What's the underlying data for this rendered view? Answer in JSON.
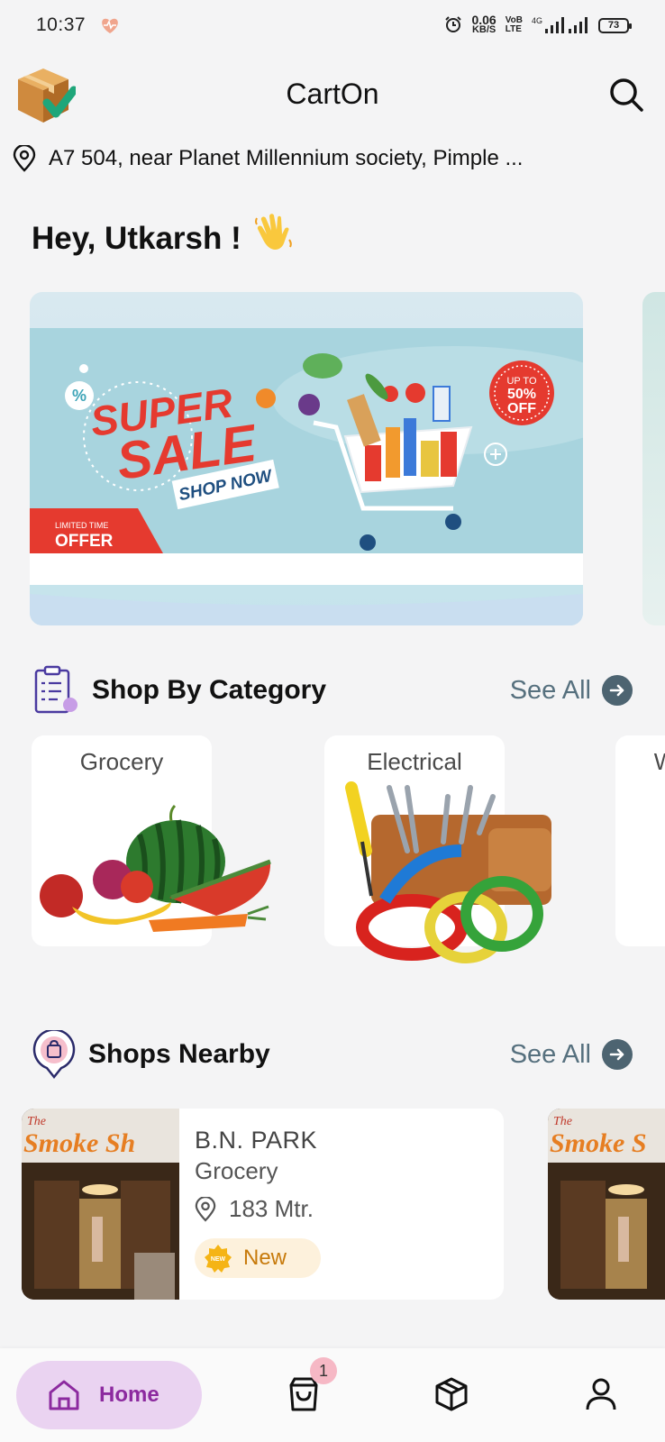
{
  "status_bar": {
    "time": "10:37",
    "net_speed_value": "0.06",
    "net_speed_unit": "KB/S",
    "volte_top": "VoB",
    "volte_bottom": "LTE",
    "signal_label": "4G",
    "battery": "73"
  },
  "header": {
    "title": "CartOn"
  },
  "address": "A7 504, near Planet Millennium society, Pimple ...",
  "greeting": {
    "text": "Hey, Utkarsh !",
    "emoji": "👋"
  },
  "banner": {
    "headline_line1": "SUPER",
    "headline_line2": "SALE",
    "cta": "SHOP NOW",
    "badge_top": "UP TO",
    "badge_value": "50%",
    "badge_bottom": "OFF",
    "ribbon_small": "LIMITED TIME",
    "ribbon_big": "OFFER",
    "percent_symbol": "%"
  },
  "categories": {
    "title": "Shop By Category",
    "see_all": "See All",
    "items": [
      {
        "label": "Grocery"
      },
      {
        "label": "Electrical"
      },
      {
        "label": "W"
      }
    ]
  },
  "shops": {
    "title": "Shops Nearby",
    "see_all": "See All",
    "items": [
      {
        "name": "B.N. PARK",
        "category": "Grocery",
        "distance": "183 Mtr.",
        "tag": "New",
        "tag_icon_text": "NEW",
        "photo_sign": "Smoke Sh",
        "photo_sign_small": "The"
      },
      {
        "photo_sign": "Smoke S",
        "photo_sign_small": "The"
      }
    ]
  },
  "bottom_nav": {
    "home": "Home",
    "cart_badge": "1"
  },
  "colors": {
    "accent": "#8c2a9f",
    "accent_bg": "#ead3f1",
    "see_all": "#56707e",
    "banner_red": "#e53a2f"
  },
  "icons": [
    "heart-pulse-icon",
    "alarm-icon",
    "signal-icon",
    "battery-icon",
    "box-check-logo",
    "search-icon",
    "location-pin-icon",
    "waving-hand-icon",
    "clipboard-icon",
    "shop-pin-icon",
    "arrow-right-icon",
    "home-icon",
    "shopping-bag-icon",
    "package-icon",
    "user-icon"
  ]
}
